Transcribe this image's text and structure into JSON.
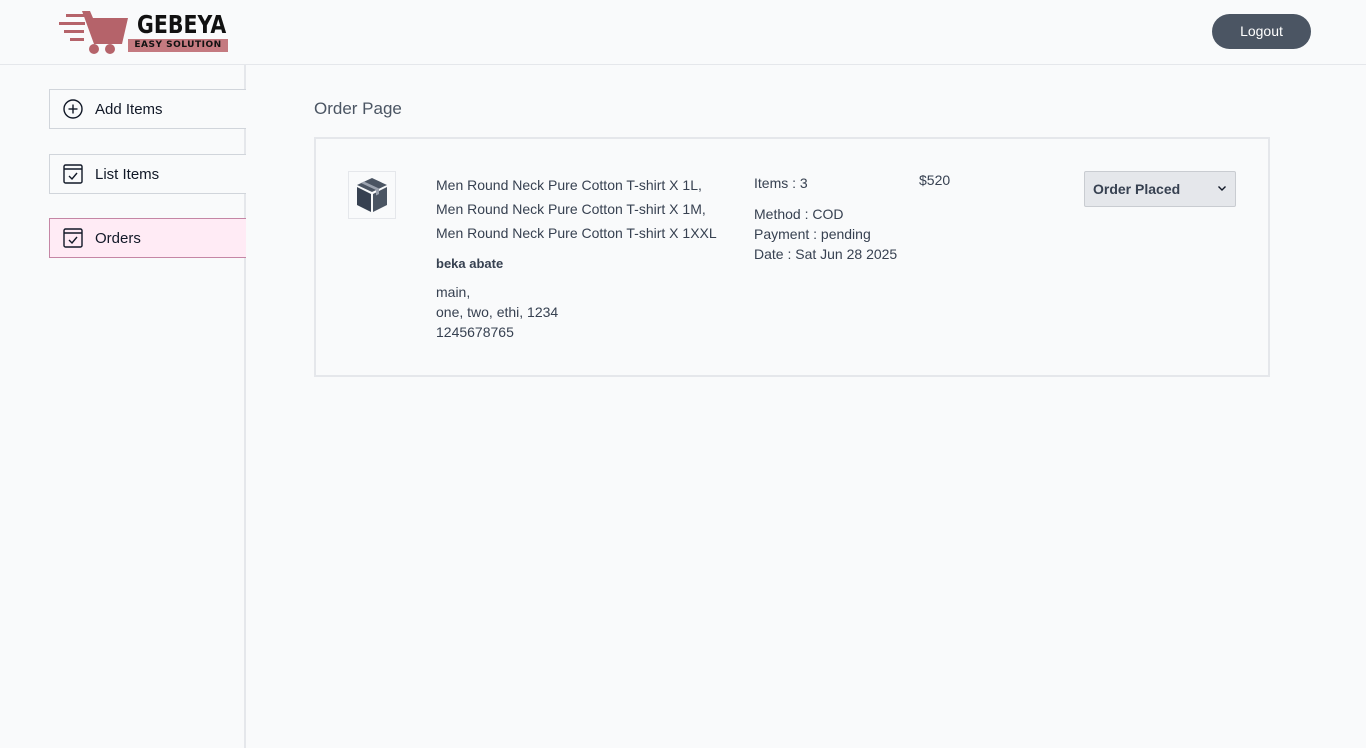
{
  "header": {
    "logo_text": "GEBEYA",
    "logo_tagline": "EASY SOLUTION",
    "logout_label": "Logout"
  },
  "sidebar": {
    "items": [
      {
        "label": "Add Items",
        "icon": "plus-circle-icon"
      },
      {
        "label": "List Items",
        "icon": "checklist-icon"
      },
      {
        "label": "Orders",
        "icon": "checklist-icon",
        "active": true
      }
    ]
  },
  "main": {
    "page_title": "Order Page",
    "orders": [
      {
        "icon": "parcel-icon",
        "items": [
          "Men Round Neck Pure Cotton T-shirt X 1L,",
          "Men Round Neck Pure Cotton T-shirt X 1M,",
          "Men Round Neck Pure Cotton T-shirt X 1XXL"
        ],
        "customer_name": "beka abate",
        "address_line1": "main,",
        "address_line2": "one, two, ethi, 1234",
        "phone": "1245678765",
        "items_count": "Items : 3",
        "method": "Method : COD",
        "payment": "Payment : pending",
        "date": "Date : Sat Jun 28 2025",
        "amount": "$520",
        "status": "Order Placed"
      }
    ]
  },
  "colors": {
    "background": "#f9fafb",
    "logout_button": "#4b5563",
    "active_item_bg": "#ffebf5",
    "active_item_border": "#c586a5",
    "logo_accent": "#c47a80"
  }
}
